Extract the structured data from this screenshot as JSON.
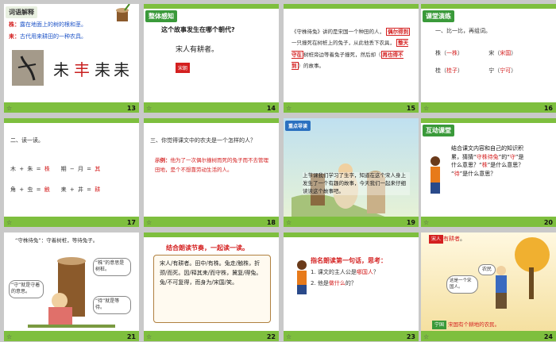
{
  "slides": [
    {
      "num": "13",
      "tag": "词语解释",
      "line1_key": "株：",
      "line1": "露在地面上的树的根和茎。",
      "line2_key": "耒：",
      "line2": "古代用来耕田的一种农具。",
      "evolve": [
        "→",
        "→",
        "耒"
      ]
    },
    {
      "num": "14",
      "tag": "整体感知",
      "q": "这个故事发生在哪个朝代?",
      "ans": "宋人有耕者。",
      "box": "宋朝"
    },
    {
      "num": "15",
      "p1": "《守株待兔》讲的是宋国一个种田的人，",
      "b1": "偶尔得到",
      "p2": "一只撞死在树桩上的兔子，从此他丢下农具，",
      "b2": "整天守在",
      "p3": "树桩旁边等着兔子撞死，然后却（",
      "b3": "再也得不到",
      "p4": "）的故事。"
    },
    {
      "num": "16",
      "tag": "课堂演练",
      "q": "一、比一比，再组词。",
      "rows": [
        [
          "株（",
          "一株",
          "）",
          "宋（",
          "宋国",
          "）"
        ],
        [
          "桂（",
          "桂子",
          "）",
          "宁（",
          "宁可",
          "）"
        ]
      ]
    },
    {
      "num": "17",
      "q": "二、读一读。",
      "r1": [
        "木",
        "+",
        "朱",
        "=",
        "株",
        "期",
        "−",
        "月",
        "=",
        "其"
      ],
      "r2": [
        "角",
        "+",
        "虫",
        "=",
        "触",
        "耒",
        "+",
        "井",
        "=",
        "耕"
      ]
    },
    {
      "num": "18",
      "q": "三、你觉得课文中的农夫是一个怎样的人？",
      "demo_label": "示例：",
      "demo": "他为了一次偶尔撞树而死的兔子而不去管理田地，是个不想靠劳动生活的人。"
    },
    {
      "num": "19",
      "tag": "重点导读",
      "text": "上节课我们学习了生字，知道在这个宋人身上发生了一个有趣的故事，今天我们一起来仔细读读这个故事吧。"
    },
    {
      "num": "20",
      "tag": "互动课堂",
      "l1": "结合课文内容和自己的知识积",
      "l2a": "累，猜猜“",
      "l2b": "守株待兔",
      "l2c": "”的“",
      "l2d": "守",
      "l2e": "”是",
      "l3a": "什么意思？“",
      "l3b": "株",
      "l3c": "”是什么意思？",
      "l4a": "“",
      "l4b": "待",
      "l4c": "”是什么意思？"
    },
    {
      "num": "21",
      "head": "“守株待兔”：守着树桩，等待兔子。",
      "c1": "“株”的意思是树桩。",
      "c2": "“守”就是守着的意思。",
      "c3": "“待”就是等待。"
    },
    {
      "num": "22",
      "tag": "结合朗读节奏，一起读一读。",
      "poem": [
        "宋人/有耕者。田中/有株。兔走/触株，折颈/而死。因/释其耒/而守株，冀复/得兔。兔/不可复得，而身为/宋国/笑。"
      ]
    },
    {
      "num": "23",
      "q": "指名朗读第一句话，思考：",
      "i1a": "1. 课文的主人公是",
      "i1b": "哪国人",
      "i1c": "？",
      "i2a": "2. 他是",
      "i2b": "做什么",
      "i2c": "的？"
    },
    {
      "num": "24",
      "top_a": "宋人",
      "top_b": "有耕者",
      "top_c": "。",
      "b1": "这是一个宋国人。",
      "b2": "农民",
      "bot_a": "宁国",
      "bot_b": "宋国有个耕地的农民。"
    }
  ]
}
